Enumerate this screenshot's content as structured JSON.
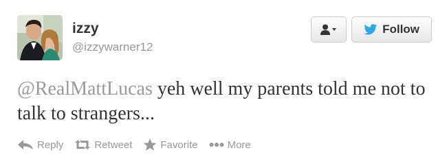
{
  "user": {
    "name": "izzy",
    "handle": "@izzywarner12",
    "avatar_icon": "profile-photo"
  },
  "header_buttons": {
    "user_dropdown_icon": "user-dropdown-icon",
    "follow_label": "Follow",
    "follow_icon": "twitter-bird-icon"
  },
  "tweet": {
    "mention": "@RealMattLucas",
    "text": " yeh well my parents told me not to talk to strangers..."
  },
  "actions": [
    {
      "label": "Reply",
      "icon": "reply-icon"
    },
    {
      "label": "Retweet",
      "icon": "retweet-icon"
    },
    {
      "label": "Favorite",
      "icon": "star-icon"
    },
    {
      "label": "More",
      "icon": "more-dots-icon"
    }
  ],
  "colors": {
    "text": "#333333",
    "muted": "#999999",
    "bird": "#2ea8e2"
  }
}
